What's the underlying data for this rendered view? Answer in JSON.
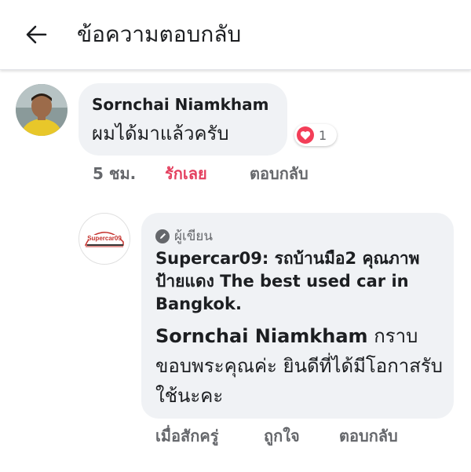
{
  "header": {
    "title": "ข้อความตอบกลับ",
    "back_icon": "arrow-left-icon"
  },
  "comment": {
    "author": "Sornchai Niamkham",
    "text": "ผมได้มาแล้วครับ",
    "reaction_icon": "heart-icon",
    "reaction_color": "#f33e58",
    "reaction_count": "1",
    "time": "5 ชม.",
    "love_label": "รักเลย",
    "reply_label": "ตอบกลับ",
    "love_color": "#e4405f"
  },
  "reply": {
    "author_badge": "ผู้เขียน",
    "badge_icon": "pencil-icon",
    "page_name": "Supercar09: รถบ้านมือ2 คุณภาพป้ายแดง The best used car in Bangkok.",
    "logo_text": "Supercar09",
    "mention": "Sornchai Niamkham",
    "text": " กราบขอบพระคุณค่ะ ยินดีที่ได้มีโอกาสรับใช้นะคะ",
    "time": "เมื่อสักครู่",
    "like_label": "ถูกใจ",
    "reply_label": "ตอบกลับ"
  }
}
